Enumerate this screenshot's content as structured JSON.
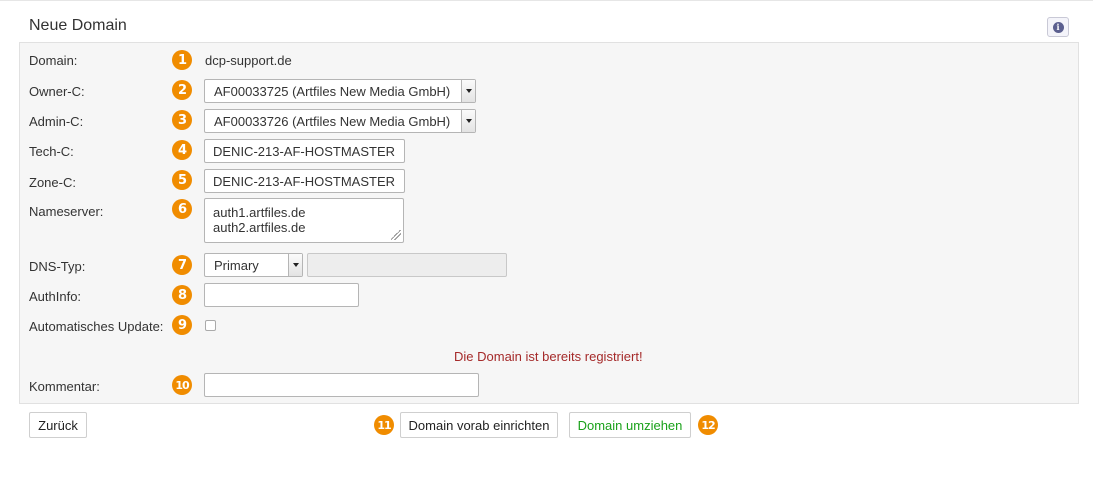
{
  "header": {
    "title": "Neue Domain",
    "info_icon": "info-icon"
  },
  "form": {
    "domain": {
      "label": "Domain:",
      "step": "1",
      "value": "dcp-support.de"
    },
    "owner_c": {
      "label": "Owner-C:",
      "step": "2",
      "value": "AF00033725 (Artfiles New Media GmbH)"
    },
    "admin_c": {
      "label": "Admin-C:",
      "step": "3",
      "value": "AF00033726 (Artfiles New Media GmbH)"
    },
    "tech_c": {
      "label": "Tech-C:",
      "step": "4",
      "value": "DENIC-213-AF-HOSTMASTER"
    },
    "zone_c": {
      "label": "Zone-C:",
      "step": "5",
      "value": "DENIC-213-AF-HOSTMASTER"
    },
    "nameserver": {
      "label": "Nameserver:",
      "step": "6",
      "lines": [
        "auth1.artfiles.de",
        "auth2.artfiles.de"
      ]
    },
    "dns_typ": {
      "label": "DNS-Typ:",
      "step": "7",
      "value": "Primary",
      "secondary_value": ""
    },
    "authinfo": {
      "label": "AuthInfo:",
      "step": "8",
      "value": ""
    },
    "auto_update": {
      "label": "Automatisches Update:",
      "step": "9",
      "checked": false
    },
    "error_message": "Die Domain ist bereits registriert!",
    "kommentar": {
      "label": "Kommentar:",
      "step": "10",
      "value": ""
    }
  },
  "actions": {
    "back_label": "Zurück",
    "setup_label": "Domain vorab einrichten",
    "setup_step": "11",
    "transfer_label": "Domain umziehen",
    "transfer_step": "12"
  },
  "colors": {
    "badge": "#f08c00",
    "error": "#a52a2a",
    "success": "#1aa11a",
    "panel_bg": "#f6f6f6"
  }
}
